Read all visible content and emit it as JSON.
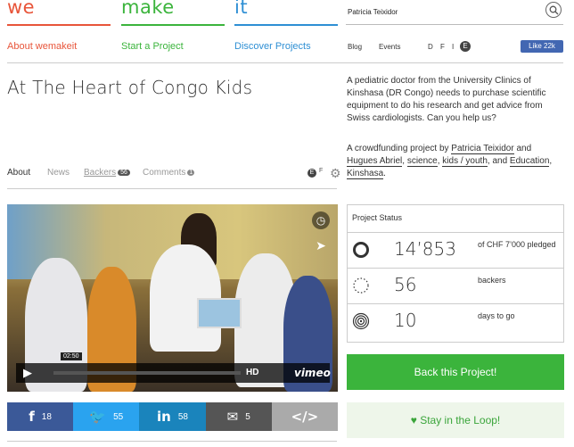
{
  "header": {
    "brand": [
      "we",
      "make",
      "it"
    ],
    "brand_colors": [
      "#e8553a",
      "#3bb43c",
      "#2e8fd4"
    ],
    "nav": [
      "About wemakeit",
      "Start a Project",
      "Discover Projects"
    ],
    "user": "Patricia Teixidor",
    "links": [
      "Blog",
      "Events"
    ],
    "langs": [
      "D",
      "F",
      "I",
      "E"
    ],
    "fb_like": "Like 22k"
  },
  "project": {
    "title": "At The Heart of Congo Kids",
    "description": "A pediatric doctor from the University Clinics of Kinshasa (DR Congo) needs to purchase scientific equipment to do his research and get advice from Swiss cardiologists. Can you help us?",
    "by_prefix": "A crowdfunding project by ",
    "authors": [
      "Patricia Teixidor",
      "Hugues Abriel"
    ],
    "and": " and ",
    "categories": [
      "science",
      "kids / youth",
      "Education",
      "Kinshasa"
    ]
  },
  "tabs": {
    "about": "About",
    "news": "News",
    "backers": "Backers",
    "backers_count": "56",
    "comments": "Comments",
    "comments_count": "1",
    "lang_e": "E",
    "lang_f": "F"
  },
  "video": {
    "time": "02:50",
    "hd": "HD",
    "provider": "vimeo",
    "progress": 0.0
  },
  "share": [
    {
      "icon": "f",
      "count": "18",
      "color": "#3b5998"
    },
    {
      "icon": "t",
      "count": "55",
      "color": "#2aa3ef"
    },
    {
      "icon": "in",
      "count": "58",
      "color": "#1a84bc"
    },
    {
      "icon": "mail",
      "count": "5",
      "color": "#555555"
    },
    {
      "icon": "</>",
      "count": "",
      "color": "#aaaaaa"
    }
  ],
  "status": {
    "heading": "Project Status",
    "pledged": "14’853",
    "pledged_label": "of CHF 7’000 pledged",
    "backers": "56",
    "backers_label": "backers",
    "days": "10",
    "days_label": "days to go"
  },
  "cta": {
    "back": "Back this Project!",
    "loop": "Stay in the Loop!"
  }
}
